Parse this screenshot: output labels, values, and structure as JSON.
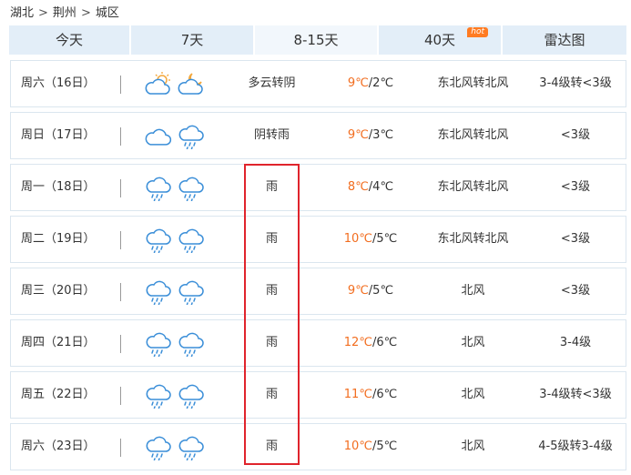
{
  "breadcrumb": {
    "province": "湖北",
    "city": "荆州",
    "district": "城区",
    "separator": ">"
  },
  "tabs": [
    {
      "label": "今天",
      "active": false,
      "width": 134
    },
    {
      "label": "7天",
      "active": false,
      "width": 136
    },
    {
      "label": "8-15天",
      "active": true,
      "width": 136
    },
    {
      "label": "40天",
      "active": false,
      "width": 136,
      "badge": "hot"
    },
    {
      "label": "雷达图",
      "active": false,
      "width": 136
    }
  ],
  "colors": {
    "accent_high_temp": "#f26d1f",
    "tab_bg": "#e3eef8",
    "highlight_border": "#e0242c",
    "icon_blue": "#3a8ed8",
    "sun_orange": "#f3a73b"
  },
  "days": [
    {
      "date": "周六（16日）",
      "icon_day": "partly-cloudy",
      "icon_night": "cloudy-night",
      "desc": "多云转阴",
      "high": "9℃",
      "low": "/2℃",
      "wind": "东北风转北风",
      "level": "3-4级转<3级"
    },
    {
      "date": "周日（17日）",
      "icon_day": "cloudy",
      "icon_night": "rain",
      "desc": "阴转雨",
      "high": "9℃",
      "low": "/3℃",
      "wind": "东北风转北风",
      "level": "<3级"
    },
    {
      "date": "周一（18日）",
      "icon_day": "rain",
      "icon_night": "rain",
      "desc": "雨",
      "high": "8℃",
      "low": "/4℃",
      "wind": "东北风转北风",
      "level": "<3级"
    },
    {
      "date": "周二（19日）",
      "icon_day": "rain",
      "icon_night": "rain",
      "desc": "雨",
      "high": "10℃",
      "low": "/5℃",
      "wind": "东北风转北风",
      "level": "<3级"
    },
    {
      "date": "周三（20日）",
      "icon_day": "rain",
      "icon_night": "rain",
      "desc": "雨",
      "high": "9℃",
      "low": "/5℃",
      "wind": "北风",
      "level": "<3级"
    },
    {
      "date": "周四（21日）",
      "icon_day": "rain",
      "icon_night": "rain",
      "desc": "雨",
      "high": "12℃",
      "low": "/6℃",
      "wind": "北风",
      "level": "3-4级"
    },
    {
      "date": "周五（22日）",
      "icon_day": "rain",
      "icon_night": "rain",
      "desc": "雨",
      "high": "11℃",
      "low": "/6℃",
      "wind": "北风",
      "level": "3-4级转<3级"
    },
    {
      "date": "周六（23日）",
      "icon_day": "rain",
      "icon_night": "rain",
      "desc": "雨",
      "high": "10℃",
      "low": "/5℃",
      "wind": "北风",
      "level": "4-5级转3-4级"
    }
  ]
}
